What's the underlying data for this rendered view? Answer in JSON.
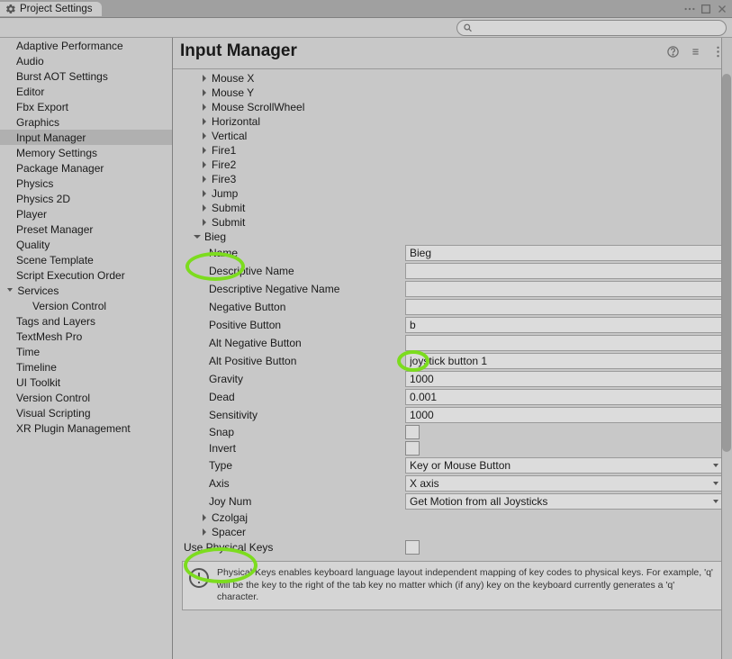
{
  "window": {
    "tab_title": "Project Settings"
  },
  "search": {
    "placeholder": ""
  },
  "sidebar": {
    "items": [
      {
        "label": "Adaptive Performance"
      },
      {
        "label": "Audio"
      },
      {
        "label": "Burst AOT Settings"
      },
      {
        "label": "Editor"
      },
      {
        "label": "Fbx Export"
      },
      {
        "label": "Graphics"
      },
      {
        "label": "Input Manager",
        "selected": true
      },
      {
        "label": "Memory Settings"
      },
      {
        "label": "Package Manager"
      },
      {
        "label": "Physics"
      },
      {
        "label": "Physics 2D"
      },
      {
        "label": "Player"
      },
      {
        "label": "Preset Manager"
      },
      {
        "label": "Quality"
      },
      {
        "label": "Scene Template"
      },
      {
        "label": "Script Execution Order"
      },
      {
        "label": "Services",
        "expandable": true
      },
      {
        "label": "Version Control",
        "child": true
      },
      {
        "label": "Tags and Layers"
      },
      {
        "label": "TextMesh Pro"
      },
      {
        "label": "Time"
      },
      {
        "label": "Timeline"
      },
      {
        "label": "UI Toolkit"
      },
      {
        "label": "Version Control"
      },
      {
        "label": "Visual Scripting"
      },
      {
        "label": "XR Plugin Management"
      }
    ]
  },
  "content": {
    "title": "Input Manager",
    "axes_collapsed": [
      "Mouse X",
      "Mouse Y",
      "Mouse ScrollWheel",
      "Horizontal",
      "Vertical",
      "Fire1",
      "Fire2",
      "Fire3",
      "Jump",
      "Submit",
      "Submit"
    ],
    "expanded_axis": {
      "name_label": "Bieg",
      "props": [
        {
          "label": "Name",
          "value": "Bieg",
          "type": "text"
        },
        {
          "label": "Descriptive Name",
          "value": "",
          "type": "text"
        },
        {
          "label": "Descriptive Negative Name",
          "value": "",
          "type": "text"
        },
        {
          "label": "Negative Button",
          "value": "",
          "type": "text"
        },
        {
          "label": "Positive Button",
          "value": "b",
          "type": "text"
        },
        {
          "label": "Alt Negative Button",
          "value": "",
          "type": "text"
        },
        {
          "label": "Alt Positive Button",
          "value": "joystick button 1",
          "type": "text"
        },
        {
          "label": "Gravity",
          "value": "1000",
          "type": "text"
        },
        {
          "label": "Dead",
          "value": "0.001",
          "type": "text"
        },
        {
          "label": "Sensitivity",
          "value": "1000",
          "type": "text"
        },
        {
          "label": "Snap",
          "value": "",
          "type": "checkbox"
        },
        {
          "label": "Invert",
          "value": "",
          "type": "checkbox"
        },
        {
          "label": "Type",
          "value": "Key or Mouse Button",
          "type": "select"
        },
        {
          "label": "Axis",
          "value": "X axis",
          "type": "select"
        },
        {
          "label": "Joy Num",
          "value": "Get Motion from all Joysticks",
          "type": "select"
        }
      ]
    },
    "axes_after": [
      "Czolgaj",
      "Spacer"
    ],
    "root_props": {
      "use_physical_keys_label": "Use Physical Keys"
    },
    "info": "Physical Keys enables keyboard language layout independent mapping of key codes to physical keys. For example, 'q' will be the key to the right of the tab key no matter which (if any) key on the keyboard currently generates a 'q' character."
  }
}
